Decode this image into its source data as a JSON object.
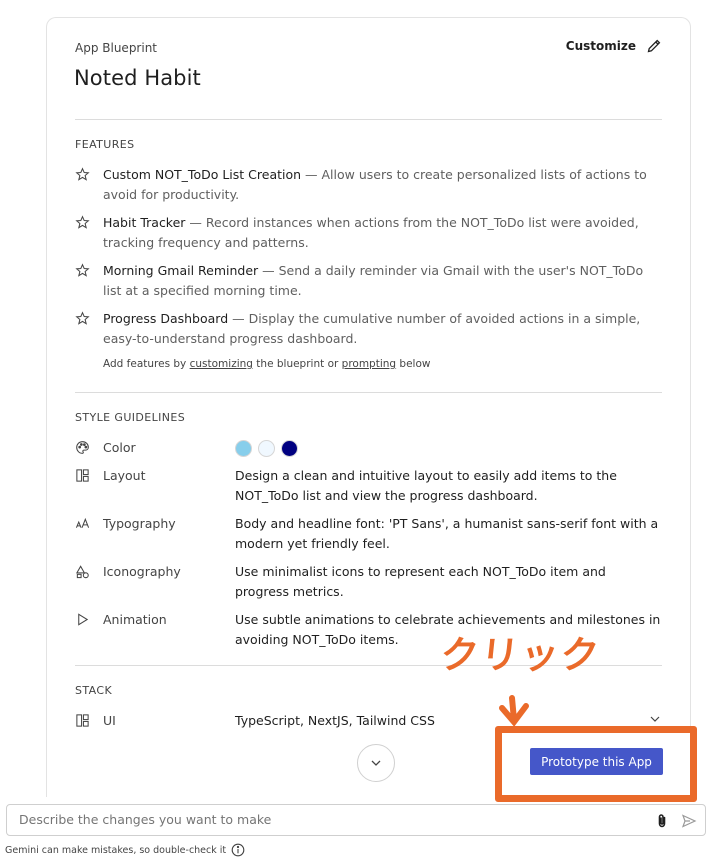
{
  "blueprint": {
    "eyebrow": "App Blueprint",
    "title": "Noted Habit",
    "customize_label": "Customize"
  },
  "features": {
    "section_title": "FEATURES",
    "items": [
      {
        "name": "Custom NOT_ToDo List Creation",
        "desc": " — Allow users to create personalized lists of actions to avoid for productivity."
      },
      {
        "name": "Habit Tracker",
        "desc": " — Record instances when actions from the NOT_ToDo list were avoided, tracking frequency and patterns."
      },
      {
        "name": "Morning Gmail Reminder",
        "desc": " — Send a daily reminder via Gmail with the user's NOT_ToDo list at a specified morning time."
      },
      {
        "name": "Progress Dashboard",
        "desc": " — Display the cumulative number of avoided actions in a simple, easy-to-understand progress dashboard."
      }
    ],
    "hint_prefix": "Add features by ",
    "hint_link1": "customizing",
    "hint_middle": " the blueprint or ",
    "hint_link2": "prompting",
    "hint_suffix": " below"
  },
  "style": {
    "section_title": "STYLE GUIDELINES",
    "color_label": "Color",
    "colors": [
      "#87ceeb",
      "#f0f8ff",
      "#000080"
    ],
    "rows": [
      {
        "label": "Layout",
        "value": "Design a clean and intuitive layout to easily add items to the NOT_ToDo list and view the progress dashboard."
      },
      {
        "label": "Typography",
        "value": "Body and headline font: 'PT Sans', a humanist sans-serif font with a modern yet friendly feel."
      },
      {
        "label": "Iconography",
        "value": "Use minimalist icons to represent each NOT_ToDo item and progress metrics."
      },
      {
        "label": "Animation",
        "value": "Use subtle animations to celebrate achievements and milestones in avoiding NOT_ToDo items."
      }
    ]
  },
  "stack": {
    "section_title": "STACK",
    "ui_label": "UI",
    "ui_value": "TypeScript, NextJS, Tailwind CSS"
  },
  "actions": {
    "prototype_label": "Prototype this App"
  },
  "annotation": {
    "text": "クリック",
    "color": "#ea6a2a"
  },
  "chat": {
    "placeholder": "Describe the changes you want to make",
    "disclaimer": "Gemini can make mistakes, so double-check it"
  },
  "accent_color": "#4557c9"
}
